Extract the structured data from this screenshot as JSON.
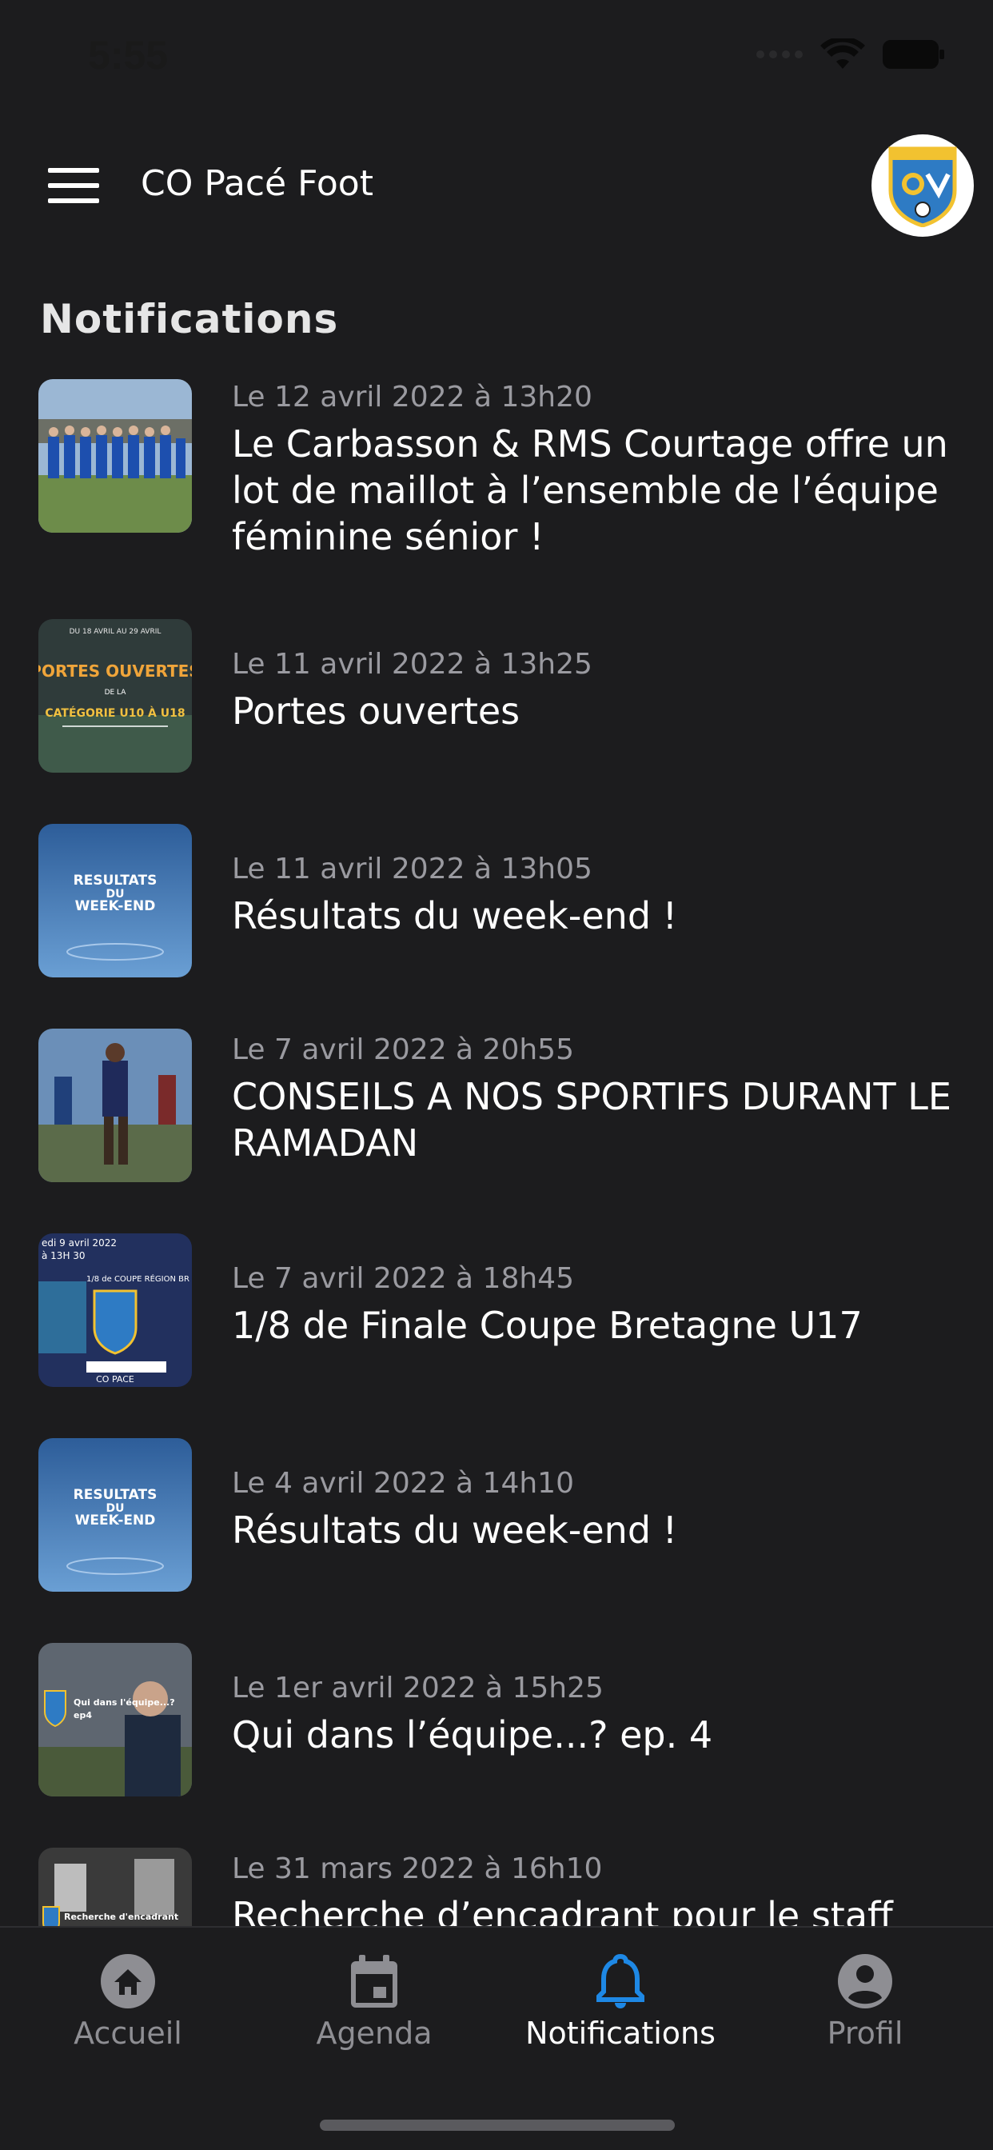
{
  "status_bar": {
    "time": "5:55"
  },
  "app_bar": {
    "title": "CO Pacé Foot"
  },
  "section": {
    "title": "Notifications"
  },
  "notifications": [
    {
      "date": "Le 12 avril 2022 à 13h20",
      "title": "Le Carbasson & RMS Courtage offre un lot de maillot à l’ensemble de l’équipe féminine sénior !"
    },
    {
      "date": "Le 11 avril 2022 à 13h25",
      "title": "Portes ouvertes",
      "thumb_text": [
        "DU 18 AVRIL AU 29 AVRIL",
        "PORTES OUVERTES",
        "DE LA",
        "CATÉGORIE U10 À U18"
      ]
    },
    {
      "date": "Le 11 avril 2022 à 13h05",
      "title": "Résultats du week-end !",
      "thumb_text": [
        "RESULTATS",
        "DU",
        "WEEK-END"
      ]
    },
    {
      "date": "Le 7 avril 2022 à 20h55",
      "title": "CONSEILS A NOS SPORTIFS DURANT LE RAMADAN"
    },
    {
      "date": "Le 7 avril 2022 à 18h45",
      "title": "1/8 de Finale Coupe Bretagne U17",
      "thumb_text": [
        "edi 9 avril 2022",
        "à 13H 30",
        "1/8 de COUPE RÉGION BR",
        "CO PACE"
      ]
    },
    {
      "date": "Le 4 avril 2022 à 14h10",
      "title": "Résultats du week-end !",
      "thumb_text": [
        "RESULTATS",
        "DU",
        "WEEK-END"
      ]
    },
    {
      "date": "Le 1er avril 2022 à 15h25",
      "title": "Qui dans l’équipe...?   ep. 4",
      "thumb_text": [
        "Qui dans l'équipe...?",
        "ep4"
      ]
    },
    {
      "date": "Le 31 mars 2022 à 16h10",
      "title": "Recherche d’encadrant pour le staff",
      "thumb_text": [
        "Recherche d'encadrant"
      ]
    }
  ],
  "tabs": [
    {
      "label": "Accueil",
      "icon": "home-icon",
      "active": false
    },
    {
      "label": "Agenda",
      "icon": "calendar-icon",
      "active": false
    },
    {
      "label": "Notifications",
      "icon": "bell-icon",
      "active": true
    },
    {
      "label": "Profil",
      "icon": "account-icon",
      "active": false
    }
  ],
  "colors": {
    "background": "#1c1c1e",
    "accent": "#1e88e5",
    "muted": "#8e8e93"
  }
}
